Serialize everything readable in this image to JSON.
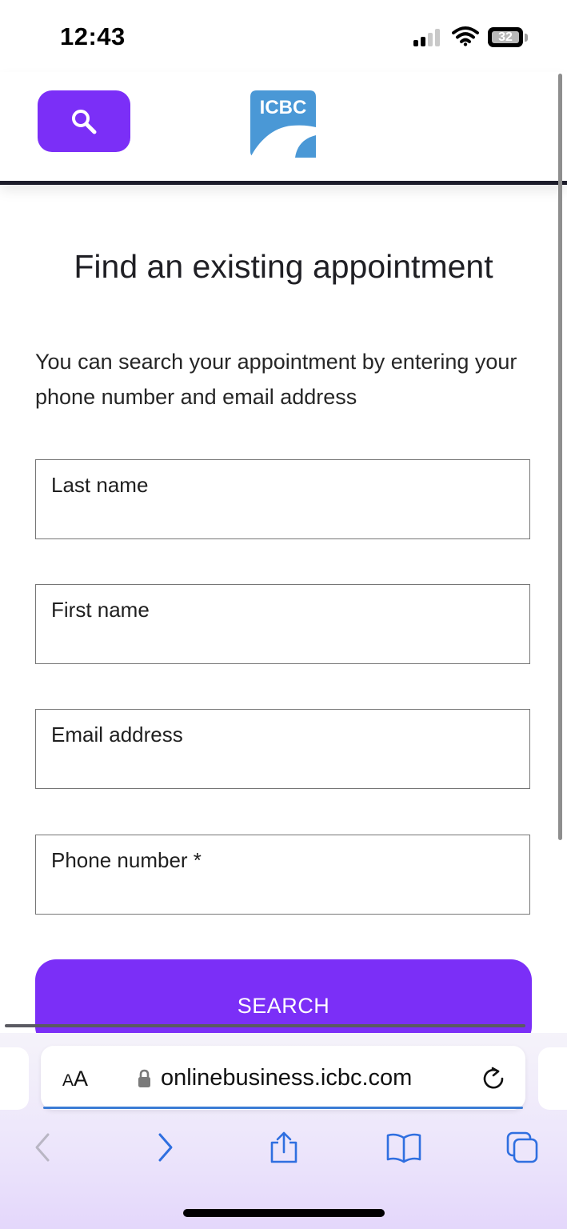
{
  "status_bar": {
    "time": "12:43",
    "battery": "32"
  },
  "header": {
    "logo_text": "ICBC",
    "search_icon": "search-icon"
  },
  "page": {
    "title": "Find an existing appointment",
    "intro": "You can search your appointment by entering your phone number and email address"
  },
  "form": {
    "last_name_label": "Last name",
    "first_name_label": "First name",
    "email_label": "Email address",
    "phone_label": "Phone number *",
    "last_name_value": "",
    "first_name_value": "",
    "email_value": "",
    "phone_value": "",
    "submit_label": "SEARCH"
  },
  "browser": {
    "text_size_label_big": "A",
    "text_size_label_small": "A",
    "url": "onlinebusiness.icbc.com",
    "icons": [
      "lock-icon",
      "reload-icon",
      "back-icon",
      "forward-icon",
      "share-icon",
      "bookmarks-icon",
      "tabs-icon"
    ]
  },
  "colors": {
    "accent": "#7b2ff7",
    "logo_blue": "#4a98d6",
    "header_line": "#1c1c2a",
    "text": "#1f1f1f"
  }
}
